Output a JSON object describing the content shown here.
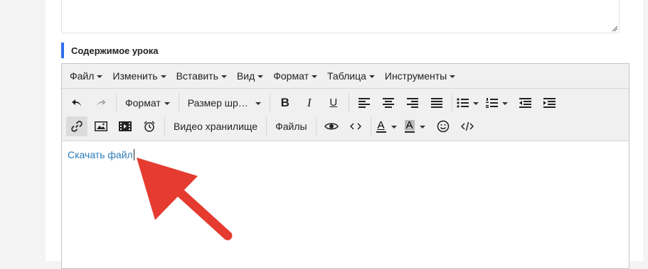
{
  "section": {
    "title": "Содержимое урока"
  },
  "menubar": [
    {
      "label": "Файл",
      "name": "menu-file"
    },
    {
      "label": "Изменить",
      "name": "menu-edit"
    },
    {
      "label": "Вставить",
      "name": "menu-insert"
    },
    {
      "label": "Вид",
      "name": "menu-view"
    },
    {
      "label": "Формат",
      "name": "menu-format"
    },
    {
      "label": "Таблица",
      "name": "menu-table"
    },
    {
      "label": "Инструменты",
      "name": "menu-tools"
    }
  ],
  "toolbar": {
    "format_select": "Формат",
    "fontsize_select": "Размер шр…",
    "video_storage": "Видео хранилище",
    "files": "Файлы",
    "bold": "B",
    "italic": "I",
    "underline": "U",
    "text_color_letter": "A",
    "bg_color_letter": "A"
  },
  "content": {
    "link_text": "Скачать файл"
  },
  "colors": {
    "accent": "#2f6fed",
    "link": "#2b7ab8",
    "arrow": "#e53b30"
  }
}
